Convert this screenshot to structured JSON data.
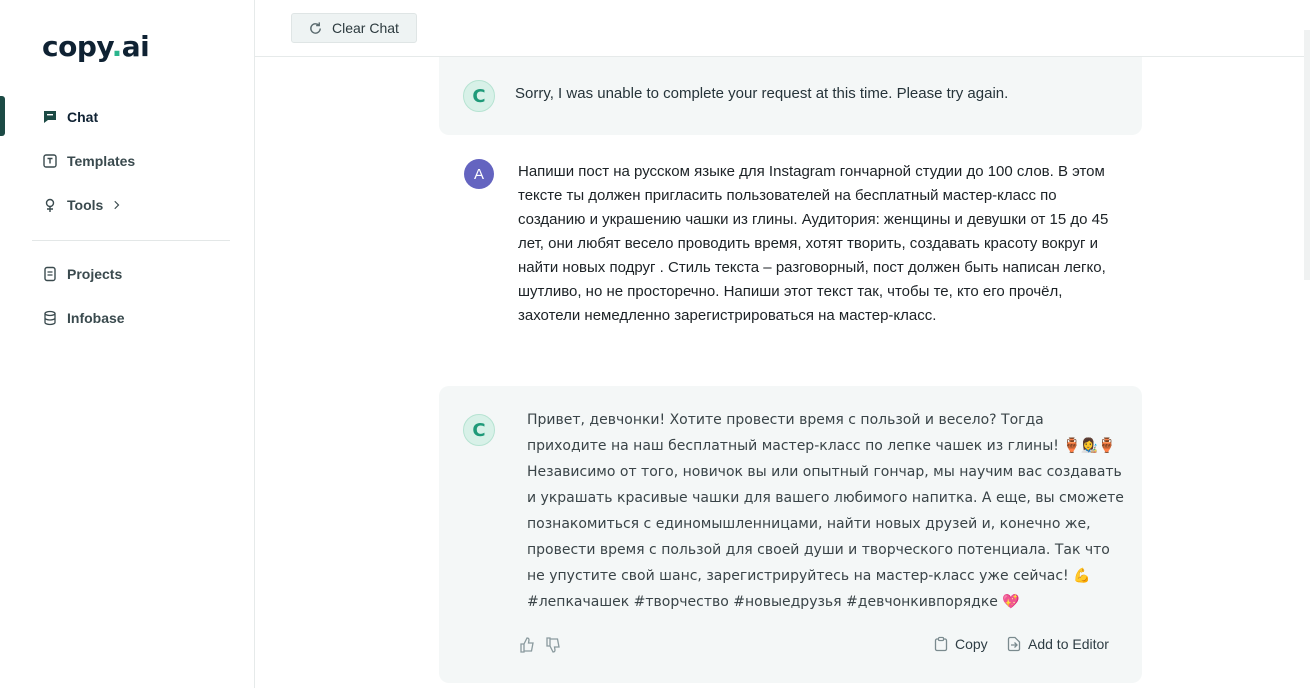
{
  "brand": {
    "name": "copy",
    "dot": ".",
    "suffix": "ai"
  },
  "sidebar": {
    "items": [
      {
        "label": "Chat",
        "icon": "chat-icon",
        "active": true
      },
      {
        "label": "Templates",
        "icon": "template-icon"
      },
      {
        "label": "Tools",
        "icon": "tools-icon",
        "chevron": "chevron-right-icon"
      },
      {
        "label": "Projects",
        "icon": "projects-icon"
      },
      {
        "label": "Infobase",
        "icon": "database-icon"
      }
    ]
  },
  "toolbar": {
    "clear_label": "Clear Chat"
  },
  "messages": {
    "ai_error": {
      "avatar": "C",
      "text": "Sorry, I was unable to complete your request at this time. Please try again."
    },
    "user": {
      "avatar": "A",
      "text": "Напиши пост на русском языке для Instagram гончарной студии до 100 слов. В этом тексте ты должен пригласить пользователей на бесплатный мастер-класс по созданию и украшению чашки из глины. Аудитория: женщины и девушки от 15 до 45 лет, они любят весело проводить время, хотят творить, создавать красоту вокруг и найти новых подруг . Стиль текста – разговорный, пост должен быть написан легко, шутливо, но не просторечно. Напиши этот текст так, чтобы те, кто его прочёл, захотели немедленно зарегистрироваться на мастер-класс."
    },
    "ai_reply": {
      "avatar": "C",
      "text": "Привет, девчонки! Хотите провести время с пользой и весело? Тогда приходите на наш бесплатный мастер-класс по лепке чашек из глины! 🏺👩‍🎨🏺 Независимо от того, новичок вы или опытный гончар, мы научим вас создавать и украшать красивые чашки для вашего любимого напитка. А еще, вы сможете познакомиться с единомышленницами, найти новых друзей и, конечно же, провести время с пользой для своей души и творческого потенциала. Так что не упустите свой шанс, зарегистрируйтесь на мастер-класс уже сейчас! 💪 #лепкачашек #творчество #новыедрузья #девчонкивпорядке 💖"
    },
    "actions": {
      "copy": "Copy",
      "add_to_editor": "Add to Editor"
    }
  },
  "colors": {
    "accent": "#1c4a45",
    "brand_dot": "#2bb58d",
    "bubble": "#f4f7f7",
    "user_avatar": "#6464c0"
  }
}
